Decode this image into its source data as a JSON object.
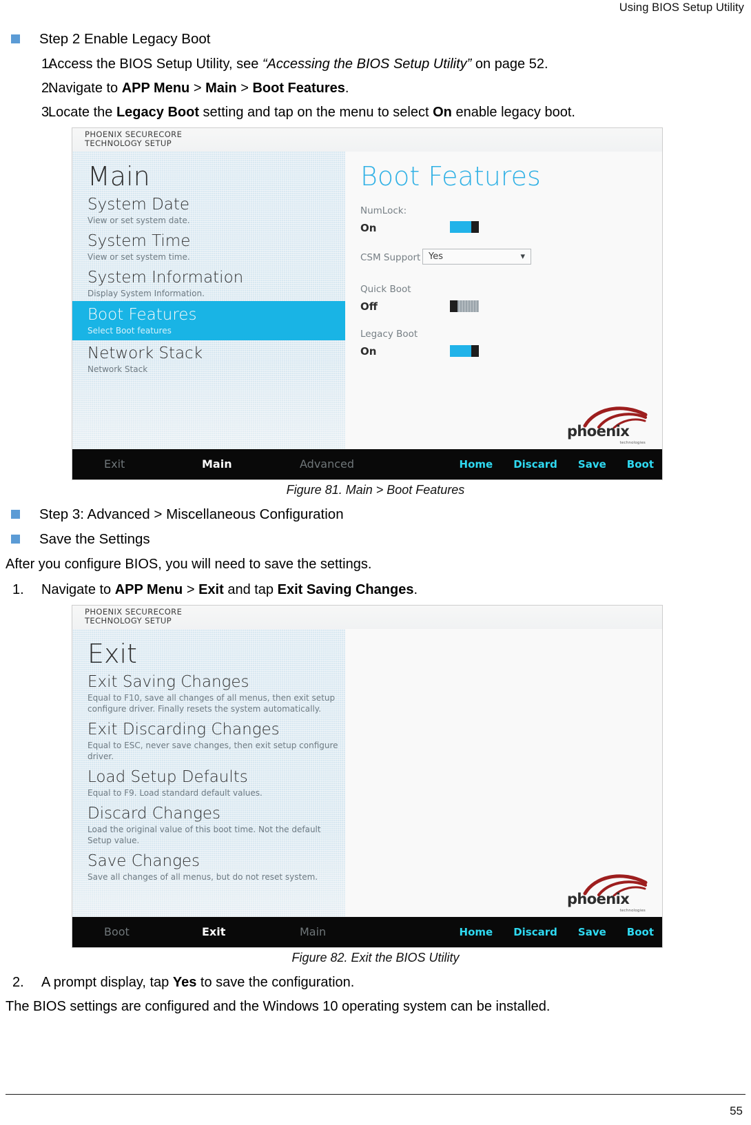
{
  "running_head": "Using BIOS Setup Utility",
  "page_number": "55",
  "content": {
    "step2_heading": "Step 2 Enable Legacy Boot",
    "step2_items": [
      {
        "num": "1.",
        "parts": [
          {
            "t": "Access the BIOS Setup Utility, see ",
            "s": "normal"
          },
          {
            "t": "“Accessing the BIOS Setup Utility”",
            "s": "italic"
          },
          {
            "t": " on page 52.",
            "s": "normal"
          }
        ]
      },
      {
        "num": "2.",
        "parts": [
          {
            "t": "Navigate to ",
            "s": "normal"
          },
          {
            "t": "APP Menu",
            "s": "bold"
          },
          {
            "t": " > ",
            "s": "normal"
          },
          {
            "t": "Main",
            "s": "bold"
          },
          {
            "t": " > ",
            "s": "normal"
          },
          {
            "t": "Boot Features",
            "s": "bold"
          },
          {
            "t": ".",
            "s": "normal"
          }
        ]
      },
      {
        "num": "3.",
        "parts": [
          {
            "t": "Locate the ",
            "s": "normal"
          },
          {
            "t": "Legacy Boot",
            "s": "bold"
          },
          {
            "t": " setting and tap on the menu to select ",
            "s": "normal"
          },
          {
            "t": "On",
            "s": "bold"
          },
          {
            "t": " enable legacy boot.",
            "s": "normal"
          }
        ]
      }
    ],
    "figure81_caption": "Figure 81.  Main > Boot Features",
    "step3_heading": "Step 3: Advanced > Miscellaneous Configuration",
    "save_heading": "Save the Settings",
    "save_intro": "After you configure BIOS, you will need to save the settings.",
    "save_items": [
      {
        "num": "1.",
        "parts": [
          {
            "t": "Navigate to ",
            "s": "normal"
          },
          {
            "t": "APP Menu",
            "s": "bold"
          },
          {
            "t": " > ",
            "s": "normal"
          },
          {
            "t": "Exit",
            "s": "bold"
          },
          {
            "t": " and tap ",
            "s": "normal"
          },
          {
            "t": "Exit Saving Changes",
            "s": "bold"
          },
          {
            "t": ".",
            "s": "normal"
          }
        ]
      }
    ],
    "figure82_caption": "Figure 82.  Exit the BIOS Utility",
    "after_items": [
      {
        "num": "2.",
        "parts": [
          {
            "t": "A prompt display, tap ",
            "s": "normal"
          },
          {
            "t": "Yes",
            "s": "bold"
          },
          {
            "t": " to save the configuration.",
            "s": "normal"
          }
        ]
      }
    ],
    "closing_para": "The BIOS settings are configured and the Windows 10 operating system can be installed."
  },
  "figure81": {
    "brand_line1": "PHOENIX SECURECORE",
    "brand_line2": "TECHNOLOGY SETUP",
    "left_pane_title": "Main",
    "left_menu": [
      {
        "title": "System Date",
        "sub": "View or set system date.",
        "selected": false
      },
      {
        "title": "System Time",
        "sub": "View or set system time.",
        "selected": false
      },
      {
        "title": "System Information",
        "sub": "Display System Information.",
        "selected": false
      },
      {
        "title": "Boot Features",
        "sub": "Select Boot features",
        "selected": true
      },
      {
        "title": "Network Stack",
        "sub": "Network Stack",
        "selected": false
      }
    ],
    "right_pane_title": "Boot Features",
    "settings": [
      {
        "label": "NumLock:",
        "value": "On",
        "control": "toggle",
        "state": "on"
      },
      {
        "label": "CSM Support",
        "value": "Yes",
        "control": "dropdown",
        "state": "yes"
      },
      {
        "label": "Quick Boot",
        "value": "Off",
        "control": "toggle",
        "state": "off"
      },
      {
        "label": "Legacy Boot",
        "value": "On",
        "control": "toggle",
        "state": "on"
      }
    ],
    "logo": {
      "wordmark": "phoenix",
      "sub": "technologies"
    },
    "nav_left": [
      {
        "label": "Exit",
        "active": false
      },
      {
        "label": "Main",
        "active": true
      },
      {
        "label": "Advanced",
        "active": false
      }
    ],
    "nav_right": [
      "Home",
      "Discard",
      "Save",
      "Boot"
    ]
  },
  "figure82": {
    "brand_line1": "PHOENIX SECURECORE",
    "brand_line2": "TECHNOLOGY SETUP",
    "left_pane_title": "Exit",
    "left_menu": [
      {
        "title": "Exit Saving Changes",
        "sub": "Equal to F10,  save all changes of all menus, then exit setup configure driver. Finally resets the system automatically."
      },
      {
        "title": "Exit Discarding Changes",
        "sub": "Equal to ESC,  never save changes, then exit setup configure driver."
      },
      {
        "title": "Load Setup Defaults",
        "sub": "Equal to F9. Load standard default values."
      },
      {
        "title": "Discard Changes",
        "sub": "Load the original value of this boot time. Not the default Setup value."
      },
      {
        "title": "Save Changes",
        "sub": "Save all changes of all menus, but do not reset system."
      }
    ],
    "logo": {
      "wordmark": "phoenix",
      "sub": "technologies"
    },
    "nav_left": [
      {
        "label": "Boot",
        "active": false
      },
      {
        "label": "Exit",
        "active": true
      },
      {
        "label": "Main",
        "active": false
      }
    ],
    "nav_right": [
      "Home",
      "Discard",
      "Save",
      "Boot"
    ]
  },
  "colors": {
    "bullet_blue": "#5b9bd5",
    "bios_accent": "#16b6e8",
    "bios_title_accent": "#2fb3e8",
    "nav_link": "#2ddcf5",
    "toggle_on": "#1eb5ec"
  }
}
